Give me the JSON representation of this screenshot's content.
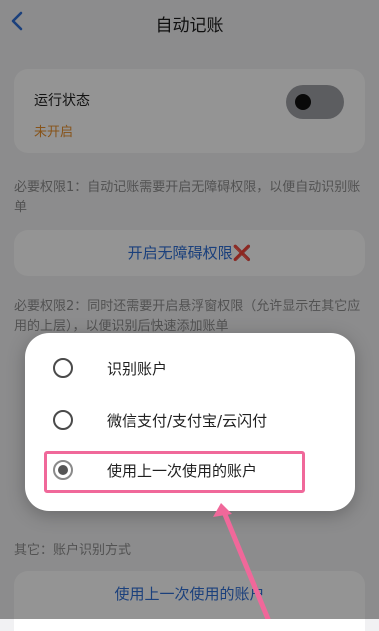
{
  "header": {
    "title": "自动记账",
    "back_icon": "chevron-left-icon"
  },
  "status": {
    "label": "运行状态",
    "value": "未开启",
    "toggle_on": false,
    "value_color": "#e8902c"
  },
  "permission1": {
    "note": "必要权限1：自动记账需要开启无障碍权限，以便自动识别账单",
    "button_label": "开启无障碍权限",
    "status_icon": "❌"
  },
  "permission2": {
    "note": "必要权限2：同时还需要开启悬浮窗权限（允许显示在其它应用的上层），以便识别后快速添加账单"
  },
  "other": {
    "label": "其它：账户识别方式",
    "value": "使用上一次使用的账户"
  },
  "dialog": {
    "options": [
      {
        "label": "识别账户",
        "selected": false
      },
      {
        "label": "微信支付/支付宝/云闪付",
        "selected": false
      },
      {
        "label": "使用上一次使用的账户",
        "selected": true
      }
    ]
  },
  "colors": {
    "accent": "#2f6fd6",
    "highlight": "#f0689a",
    "warning": "#e8902c"
  }
}
